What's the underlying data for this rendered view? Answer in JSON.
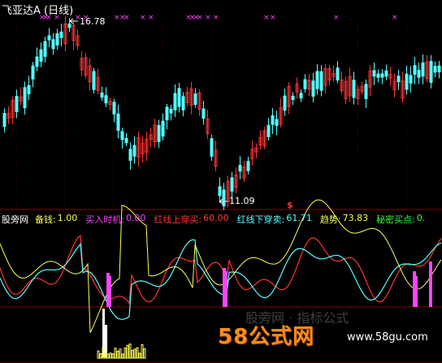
{
  "window": {
    "title": "飞亚达A (日线)"
  },
  "price_labels": {
    "high": "16.78",
    "low": "11.09"
  },
  "signal_marker": "$",
  "indicator_bar": {
    "name": "股旁网",
    "items": [
      {
        "label": "备钱:",
        "value": "1.00",
        "color": "#ffff55"
      },
      {
        "label": "买入时机:",
        "value": "0.00",
        "color": "#ff44ff"
      },
      {
        "label": "红线上穿买:",
        "value": "60.00",
        "color": "#ff3333"
      },
      {
        "label": "红线下穿卖:",
        "value": "61.71",
        "color": "#55ffff"
      },
      {
        "label": "趋势:",
        "value": "73.83",
        "color": "#ffff55"
      },
      {
        "label": "秘密买点:",
        "value": "0.",
        "color": "#33ff33"
      }
    ]
  },
  "watermark": {
    "brand": "58公式网",
    "url": "www.58gu.com",
    "faint": "股旁网 · 指标公式"
  },
  "colors": {
    "up": "#ff3333",
    "down": "#55ffff",
    "grid": "#8b0000",
    "marker": "#ff44ff",
    "trend": "#ffff55",
    "white": "#ffffff"
  }
}
